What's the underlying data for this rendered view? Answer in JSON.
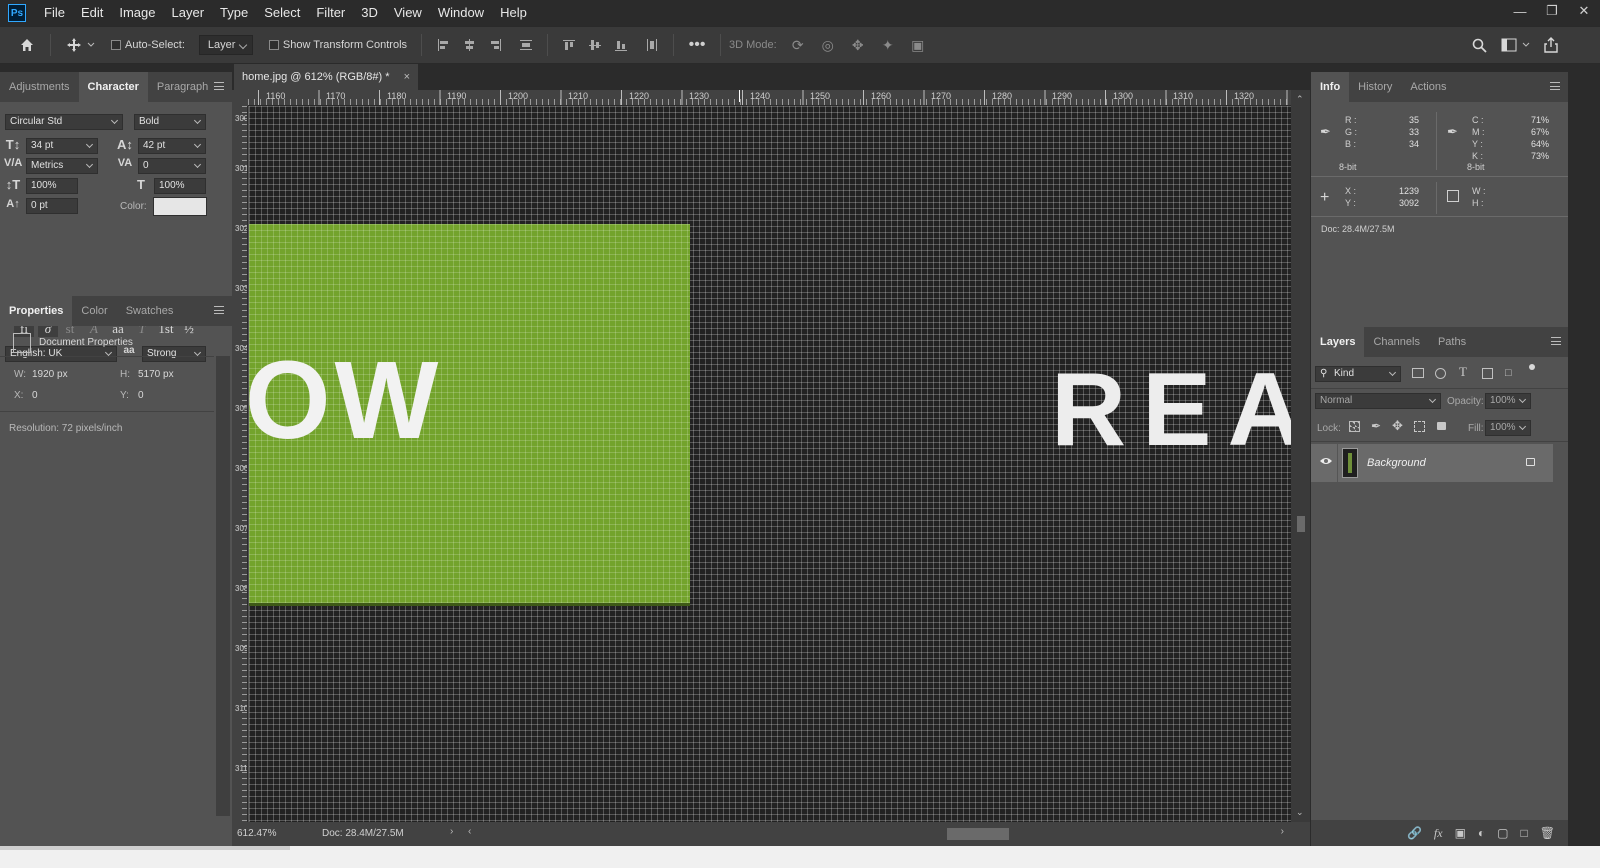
{
  "menubar": {
    "logo": "Ps",
    "items": [
      "File",
      "Edit",
      "Image",
      "Layer",
      "Type",
      "Select",
      "Filter",
      "3D",
      "View",
      "Window",
      "Help"
    ],
    "window_controls": [
      "minimize",
      "restore",
      "close"
    ]
  },
  "options": {
    "auto_select_label": "Auto-Select:",
    "auto_select_target": "Layer",
    "show_transform_label": "Show Transform Controls",
    "three_d_mode_label": "3D Mode:"
  },
  "character_panel": {
    "tabs": [
      "Adjustments",
      "Character",
      "Paragraph"
    ],
    "active_tab": "Character",
    "font_family": "Circular Std",
    "font_style": "Bold",
    "font_size": "34 pt",
    "leading": "42 pt",
    "kerning": "Metrics",
    "tracking": "0",
    "vertical_scale": "100%",
    "horizontal_scale": "100%",
    "baseline_shift": "0 pt",
    "color_label": "Color:",
    "color_value": "#e6e6e6",
    "language": "English: UK",
    "antialias": "Strong"
  },
  "properties_panel": {
    "tabs": [
      "Properties",
      "Color",
      "Swatches"
    ],
    "active_tab": "Properties",
    "section_title": "Document Properties",
    "w_label": "W:",
    "w_value": "1920 px",
    "h_label": "H:",
    "h_value": "5170 px",
    "x_label": "X:",
    "x_value": "0",
    "y_label": "Y:",
    "y_value": "0",
    "resolution": "Resolution: 72 pixels/inch"
  },
  "document": {
    "tab_title": "home.jpg @ 612% (RGB/8#) *",
    "canvas_text_left": "OW",
    "canvas_text_right": "READ",
    "green_color": "#73a32c",
    "ruler_top_labels": [
      "1160",
      "1170",
      "1180",
      "1190",
      "1200",
      "1210",
      "1220",
      "1230",
      "1240",
      "1250",
      "1260",
      "1270",
      "1280",
      "1290",
      "1300",
      "1310",
      "1320"
    ],
    "ruler_left_labels": [
      "3004",
      "3010",
      "3020",
      "3030",
      "3040",
      "3050",
      "3060",
      "3070",
      "3080",
      "3090",
      "3100",
      "3110",
      "3120",
      "3130",
      "3140"
    ]
  },
  "status": {
    "zoom": "612.47%",
    "doc_size": "Doc: 28.4M/27.5M"
  },
  "info_panel": {
    "tabs": [
      "Info",
      "History",
      "Actions"
    ],
    "active_tab": "Info",
    "r_label": "R :",
    "r": "35",
    "g_label": "G :",
    "g": "33",
    "b_label": "B :",
    "b": "34",
    "bit_left": "8-bit",
    "c_label": "C :",
    "c": "71%",
    "m_label": "M :",
    "m": "67%",
    "y_label": "Y :",
    "y": "64%",
    "k_label": "K :",
    "k": "73%",
    "bit_right": "8-bit",
    "x_label": "X :",
    "x": "1239",
    "ycoord_label": "Y :",
    "ycoord": "3092",
    "w_label": "W :",
    "h_label": "H :",
    "doc_size": "Doc: 28.4M/27.5M"
  },
  "layers_panel": {
    "tabs": [
      "Layers",
      "Channels",
      "Paths"
    ],
    "active_tab": "Layers",
    "filter_placeholder": "Kind",
    "blend_mode": "Normal",
    "opacity_label": "Opacity:",
    "opacity": "100%",
    "lock_label": "Lock:",
    "fill_label": "Fill:",
    "fill": "100%",
    "layers": [
      {
        "name": "Background",
        "visible": true,
        "locked": true
      }
    ]
  }
}
